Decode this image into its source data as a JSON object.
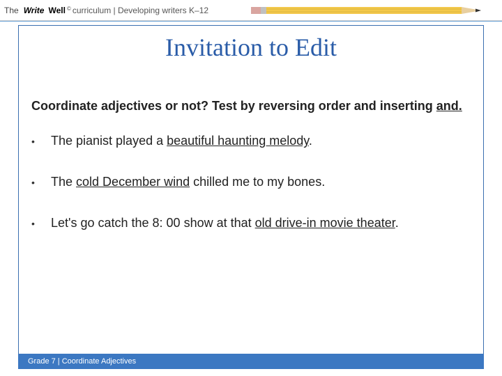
{
  "header": {
    "brand_the": "The",
    "brand_write": "Write",
    "brand_well": "Well",
    "brand_copy": "©",
    "brand_rest": " curriculum | Developing writers K–12"
  },
  "slide": {
    "title": "Invitation to Edit",
    "instruction_pre": "Coordinate adjectives or not? Test by reversing order and inserting ",
    "instruction_and": "and.",
    "bullets": [
      {
        "pre": "The pianist played a ",
        "u": "beautiful haunting melody",
        "post": "."
      },
      {
        "pre": "The ",
        "u": "cold December wind",
        "post": " chilled me to my bones."
      },
      {
        "pre": "Let's go catch the 8: 00 show at that ",
        "u": "old drive-in movie theater",
        "post": "."
      }
    ]
  },
  "footer": {
    "text": "Grade 7 | Coordinate Adjectives"
  }
}
